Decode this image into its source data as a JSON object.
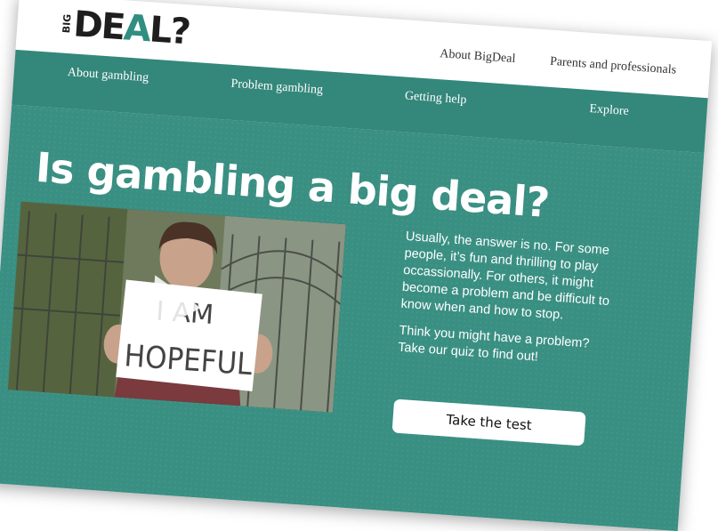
{
  "brand": {
    "logo_small": "BIG",
    "logo_main_1": "DE",
    "logo_main_2": "A",
    "logo_main_3": "L?",
    "accent_color": "#3a8f83"
  },
  "utility_nav": {
    "about": "About BigDeal",
    "parents": "Parents and professionals"
  },
  "main_nav": {
    "items": [
      {
        "label": "About gambling"
      },
      {
        "label": "Problem gambling"
      },
      {
        "label": "Getting help"
      },
      {
        "label": "Explore"
      }
    ]
  },
  "hero": {
    "title": "Is gambling a big deal?",
    "video": {
      "sign_line_1": "I AM",
      "sign_line_2": "HOPEFUL"
    },
    "paragraph_1": "Usually, the answer is no. For some people, it’s fun and thrilling to play occassionally. For others, it might become a problem and be difficult to know when and how to stop.",
    "paragraph_2": "Think you might have a problem? Take our quiz to find out!",
    "cta_label": "Take the test"
  }
}
